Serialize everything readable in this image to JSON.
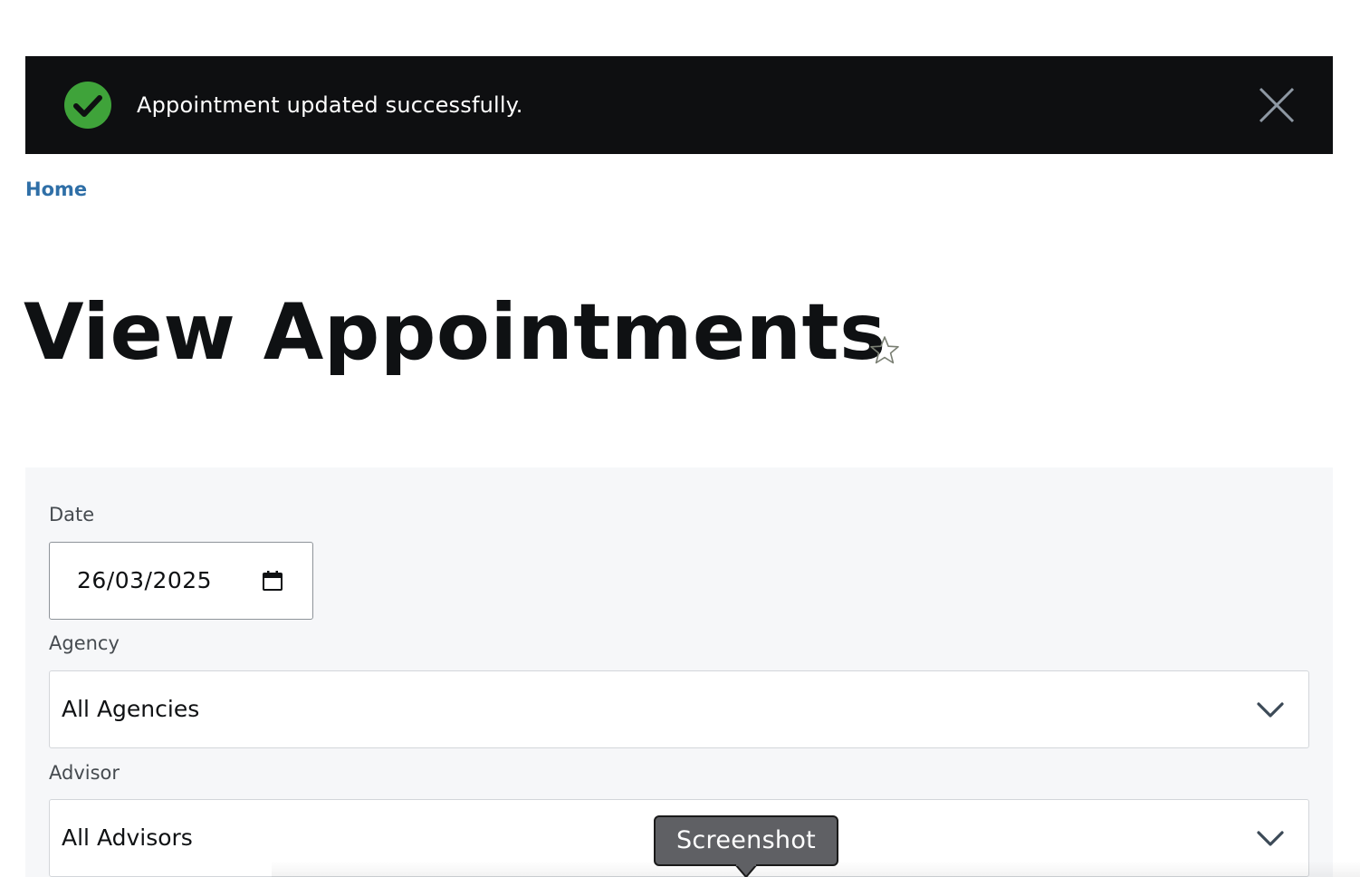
{
  "banner": {
    "message": "Appointment updated successfully.",
    "status_icon": "check-circle-icon",
    "close_icon": "close-icon",
    "colors": {
      "background": "#0e0f11",
      "success": "#3fa33a",
      "close": "#8e98a3"
    }
  },
  "breadcrumb": {
    "home_label": "Home",
    "color": "#2f6fa7"
  },
  "page": {
    "title": "View Appointments",
    "favorite_icon": "star-outline-icon"
  },
  "filters": {
    "date": {
      "label": "Date",
      "value": "26/03/2025",
      "icon": "calendar-icon"
    },
    "agency": {
      "label": "Agency",
      "selected": "All Agencies",
      "icon": "chevron-down-icon"
    },
    "advisor": {
      "label": "Advisor",
      "selected": "All Advisors",
      "icon": "chevron-down-icon"
    }
  },
  "tooltip": {
    "text": "Screenshot"
  }
}
